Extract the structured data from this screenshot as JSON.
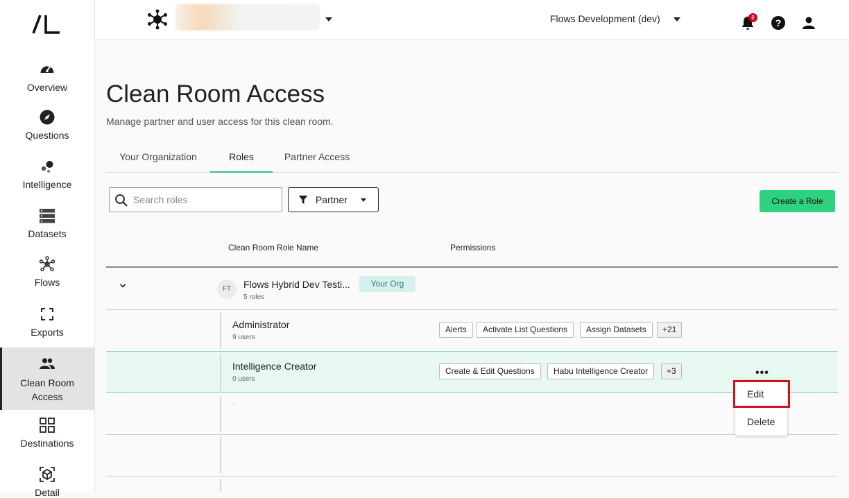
{
  "sidebar": {
    "logo": "/L",
    "items": [
      {
        "label": "Overview",
        "icon": "gauge-icon"
      },
      {
        "label": "Questions",
        "icon": "compass-icon"
      },
      {
        "label": "Intelligence",
        "icon": "bubbles-icon"
      },
      {
        "label": "Datasets",
        "icon": "database-icon"
      },
      {
        "label": "Flows",
        "icon": "network-icon"
      },
      {
        "label": "Exports",
        "icon": "export-frame-icon"
      },
      {
        "label": "Clean Room Access",
        "icon": "people-icon"
      },
      {
        "label": "Destinations",
        "icon": "grid-icon"
      },
      {
        "label": "Detail",
        "icon": "cube-icon"
      }
    ]
  },
  "topbar": {
    "environment": "Flows Development (dev)",
    "notification_count": "8"
  },
  "page": {
    "title": "Clean Room Access",
    "subtitle": "Manage partner and user access for this clean room."
  },
  "tabs": [
    "Your Organization",
    "Roles",
    "Partner Access"
  ],
  "toolbar": {
    "search_placeholder": "Search roles",
    "filter_label": "Partner",
    "create_label": "Create a Role"
  },
  "table": {
    "headers": [
      "Clean Room Role Name",
      "Permissions"
    ],
    "org": {
      "initials": "FT",
      "name": "Flows Hybrid Dev Testi...",
      "count": "5 roles",
      "tag": "Your Org"
    },
    "roles": [
      {
        "name": "Administrator",
        "users": "9 users",
        "permissions": [
          "Alerts",
          "Activate List Questions",
          "Assign Datasets"
        ],
        "more": "+21"
      },
      {
        "name": "Intelligence Creator",
        "users": "0 users",
        "permissions": [
          "Create & Edit Questions",
          "Habu Intelligence Creator"
        ],
        "more": "+3"
      }
    ]
  },
  "context_menu": [
    "Edit",
    "Delete"
  ],
  "colors": {
    "accent_green": "#2ed17e",
    "highlight_row": "#e6f8ef",
    "tag_bg": "#d8efef",
    "alert_red": "#d0021b"
  }
}
